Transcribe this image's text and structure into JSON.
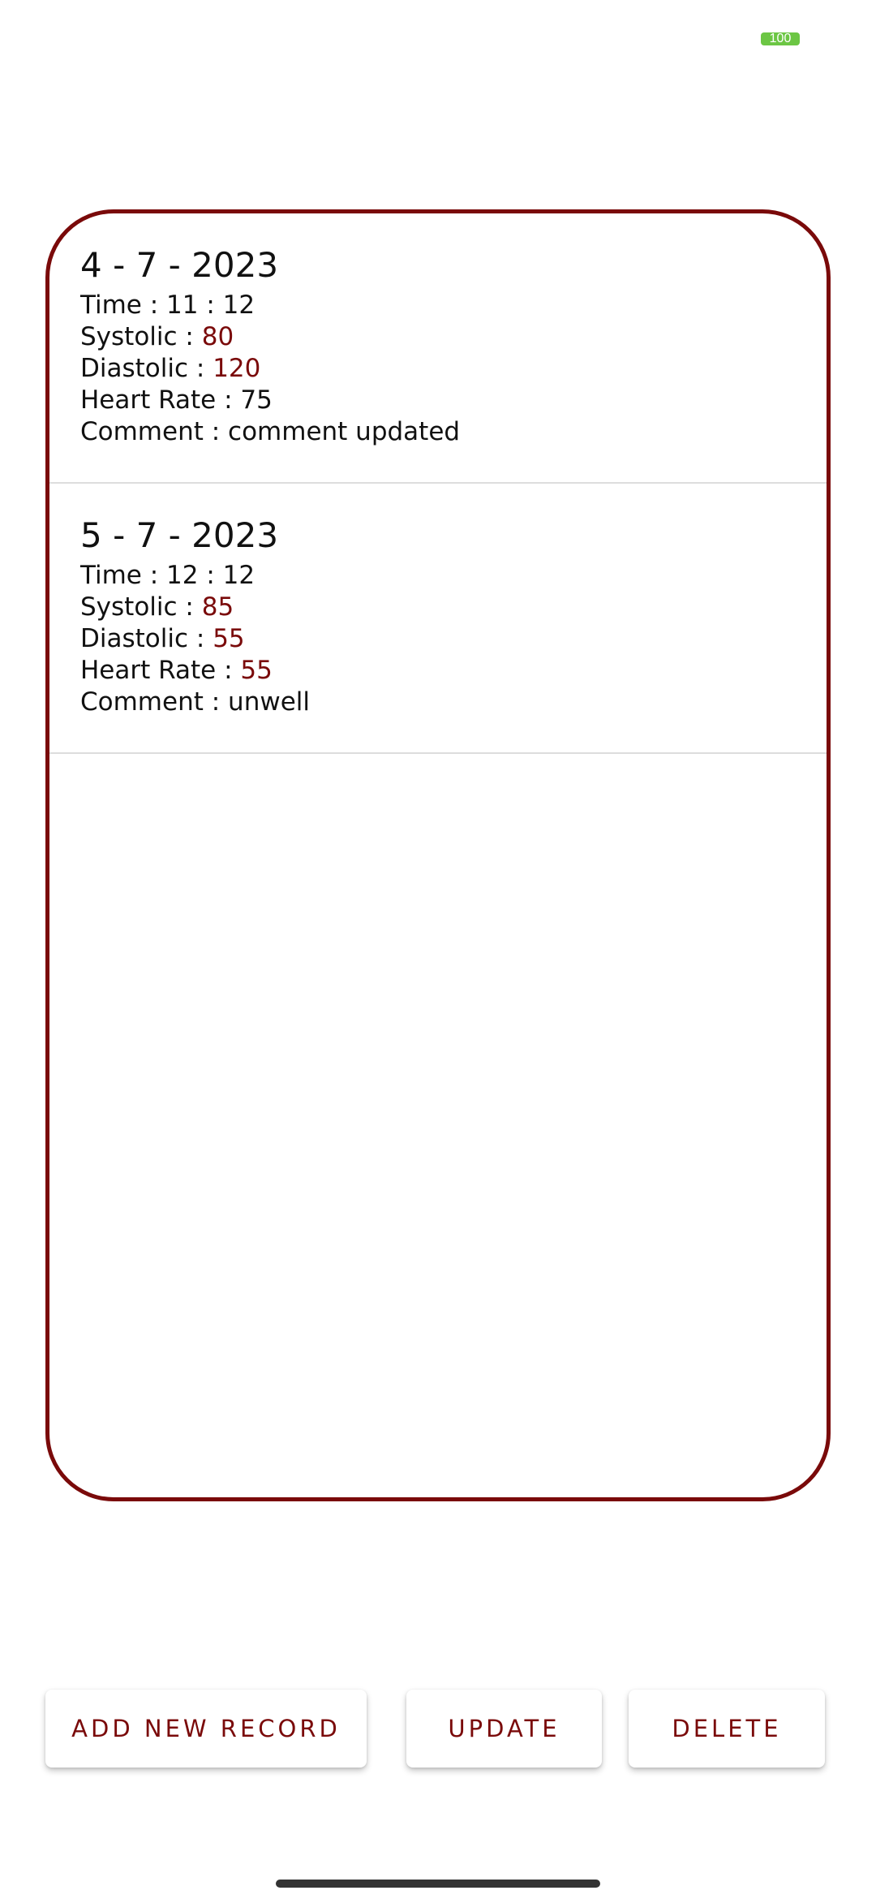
{
  "status_bar": {
    "battery_level": "100",
    "battery_color": "#6cc644"
  },
  "theme": {
    "accent": "#7a0a0a"
  },
  "records": [
    {
      "date": "4 - 7 - 2023",
      "time_label": "Time : ",
      "time": "11 : 12",
      "systolic_label": "Systolic : ",
      "systolic": "80",
      "diastolic_label": "Diastolic : ",
      "diastolic": "120",
      "heart_rate_label": "Heart Rate : ",
      "heart_rate": "75",
      "comment_label": "Comment : ",
      "comment": "comment updated"
    },
    {
      "date": "5 - 7 - 2023",
      "time_label": "Time : ",
      "time": "12 : 12",
      "systolic_label": "Systolic : ",
      "systolic": "85",
      "diastolic_label": "Diastolic : ",
      "diastolic": "55",
      "heart_rate_label": "Heart Rate : ",
      "heart_rate": "55",
      "comment_label": "Comment : ",
      "comment": "unwell"
    }
  ],
  "actions": {
    "add_label": "ADD NEW RECORD",
    "update_label": "UPDATE",
    "delete_label": "DELETE"
  }
}
